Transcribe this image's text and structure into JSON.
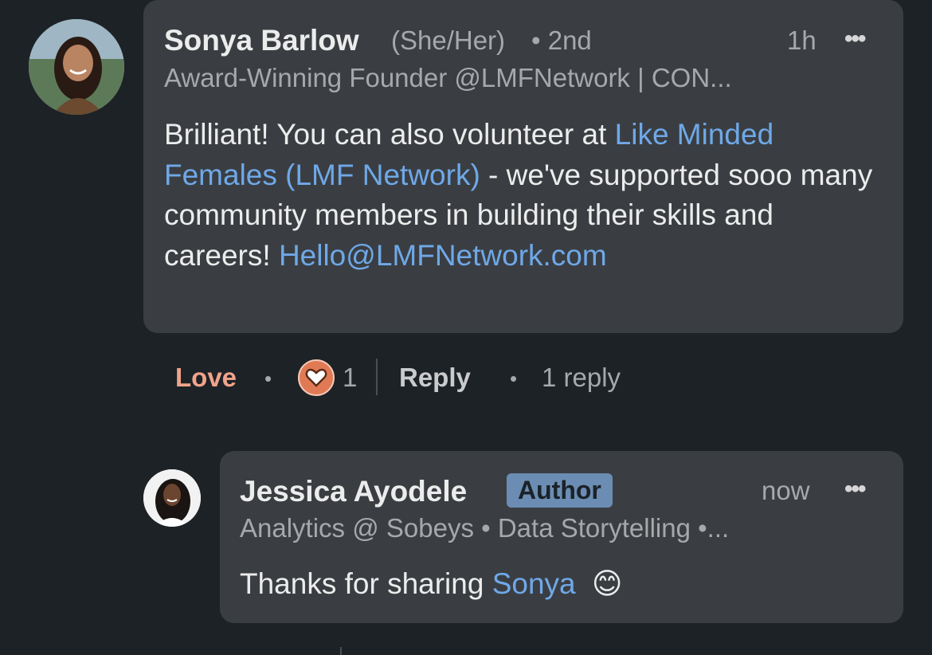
{
  "comment": {
    "author_name": "Sonya Barlow",
    "pronouns": "(She/Her)",
    "degree": "• 2nd",
    "time": "1h",
    "more": "•••",
    "headline": "Award-Winning Founder @LMFNetwork | CON...",
    "text_part1": "Brilliant! You can also volunteer at ",
    "link1": "Like Minded Females (LMF Network)",
    "text_part2": " - we've supported sooo many community members in building their skills and careers! ",
    "link2": "Hello@LMFNetwork.com",
    "reaction_label": "Love",
    "reaction_count": "1",
    "reply_label": "Reply",
    "reply_count": "1 reply",
    "sep_dot": "•"
  },
  "reply": {
    "author_name": "Jessica Ayodele",
    "badge": "Author",
    "time": "now",
    "more": "•••",
    "headline": "Analytics @ Sobeys • Data Storytelling •...",
    "text_part1": "Thanks for sharing ",
    "mention": "Sonya",
    "emoji": "😊"
  },
  "colors": {
    "background": "#1d2226",
    "bubble": "#3a3e42",
    "link": "#6fa8e8",
    "love": "#f0a48c"
  }
}
